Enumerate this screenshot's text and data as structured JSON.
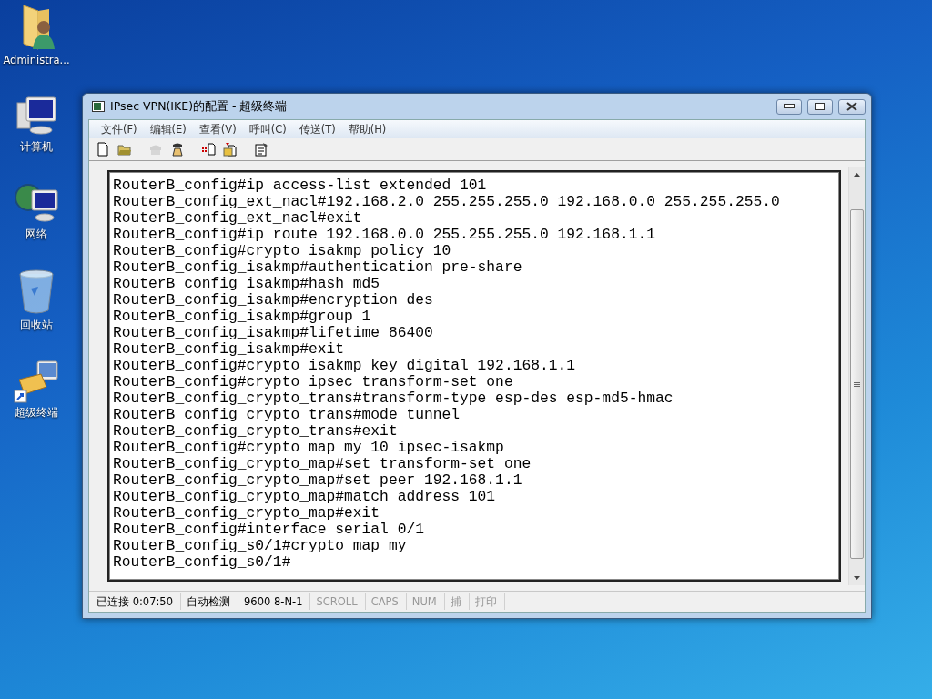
{
  "desktop_icons": [
    {
      "label": "Administra...",
      "kind": "user-folder"
    },
    {
      "label": "计算机",
      "kind": "computer"
    },
    {
      "label": "网络",
      "kind": "network"
    },
    {
      "label": "回收站",
      "kind": "recycle-bin"
    },
    {
      "label": "超级终端",
      "kind": "terminal-shortcut"
    }
  ],
  "window": {
    "title": "IPsec VPN(IKE)的配置 - 超级终端"
  },
  "menu": [
    "文件(F)",
    "编辑(E)",
    "查看(V)",
    "呼叫(C)",
    "传送(T)",
    "帮助(H)"
  ],
  "toolbar": [
    {
      "kind": "new",
      "disabled": false
    },
    {
      "kind": "open",
      "disabled": false
    },
    {
      "kind": "call",
      "disabled": true
    },
    {
      "kind": "disconnect",
      "disabled": false
    },
    {
      "kind": "send",
      "disabled": false
    },
    {
      "kind": "receive",
      "disabled": false
    },
    {
      "kind": "properties",
      "disabled": false
    }
  ],
  "terminal_lines": [
    "RouterB_config#ip access-list extended 101",
    "RouterB_config_ext_nacl#192.168.2.0 255.255.255.0 192.168.0.0 255.255.255.0",
    "RouterB_config_ext_nacl#exit",
    "RouterB_config#ip route 192.168.0.0 255.255.255.0 192.168.1.1",
    "RouterB_config#crypto isakmp policy 10",
    "RouterB_config_isakmp#authentication pre-share",
    "RouterB_config_isakmp#hash md5",
    "RouterB_config_isakmp#encryption des",
    "RouterB_config_isakmp#group 1",
    "RouterB_config_isakmp#lifetime 86400",
    "RouterB_config_isakmp#exit",
    "RouterB_config#crypto isakmp key digital 192.168.1.1",
    "RouterB_config#crypto ipsec transform-set one",
    "RouterB_config_crypto_trans#transform-type esp-des esp-md5-hmac",
    "RouterB_config_crypto_trans#mode tunnel",
    "RouterB_config_crypto_trans#exit",
    "RouterB_config#crypto map my 10 ipsec-isakmp",
    "RouterB_config_crypto_map#set transform-set one",
    "RouterB_config_crypto_map#set peer 192.168.1.1",
    "RouterB_config_crypto_map#match address 101",
    "RouterB_config_crypto_map#exit",
    "RouterB_config#interface serial 0/1",
    "RouterB_config_s0/1#crypto map my",
    "RouterB_config_s0/1#"
  ],
  "status_bar": [
    {
      "text": "已连接 0:07:50",
      "disabled": false
    },
    {
      "text": "自动检测",
      "disabled": false
    },
    {
      "text": "9600 8-N-1",
      "disabled": false
    },
    {
      "text": "SCROLL",
      "disabled": true
    },
    {
      "text": "CAPS",
      "disabled": true
    },
    {
      "text": "NUM",
      "disabled": true
    },
    {
      "text": "捕",
      "disabled": true
    },
    {
      "text": "打印",
      "disabled": true
    }
  ]
}
